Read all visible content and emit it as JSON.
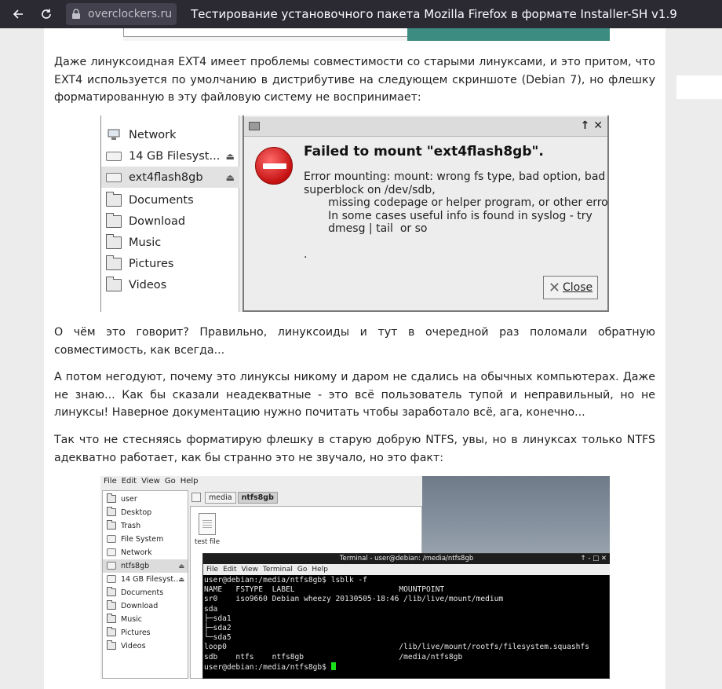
{
  "browser": {
    "domain": "overclockers.ru",
    "title": "Тестирование установочного пакета Mozilla Firefox в формате Installer-SH v1.9:..."
  },
  "article": {
    "p1": "Даже линуксоидная EXT4 имеет проблемы совместимости со старыми линуксами, и это притом, что EXT4 используется по умолчанию в дистрибутиве на следующем скриншоте (Debian 7), но флешку форматированную в эту файловую систему не воспринимает:",
    "p2": "О чём это говорит? Правильно, линуксоиды и тут в очередной раз поломали обратную совместимость, как всегда...",
    "p3": "А потом негодуют, почему это линуксы никому и даром не сдались на обычных компьютерах. Даже не знаю... Как бы сказали неадекватные - это всё пользователь тупой и неправильный, но не линуксы! Наверное документацию нужно почитать чтобы заработало всё, ага, конечно...",
    "p4": "Так что не стесняясь форматирую флешку в старую добрую NTFS, увы, но в линуксах только NTFS адекватно работает, как бы странно это не звучало, но это факт:"
  },
  "shot1": {
    "sidebar": [
      {
        "label": "Network",
        "icon": "network-icon"
      },
      {
        "label": "14 GB Filesyst...",
        "icon": "drive-icon"
      },
      {
        "label": "ext4flash8gb",
        "icon": "drive-icon"
      },
      {
        "label": "Documents",
        "icon": "folder-icon"
      },
      {
        "label": "Download",
        "icon": "folder-icon"
      },
      {
        "label": "Music",
        "icon": "folder-icon"
      },
      {
        "label": "Pictures",
        "icon": "folder-icon"
      },
      {
        "label": "Videos",
        "icon": "folder-icon"
      }
    ],
    "dialog": {
      "title_buttons": "↑ ✕",
      "heading": "Failed to mount \"ext4flash8gb\".",
      "message": "Error mounting: mount: wrong fs type, bad option, bad\nsuperblock on /dev/sdb,\n       missing codepage or helper program, or other error\n       In some cases useful info is found in syslog - try\n       dmesg | tail  or so\n\n.",
      "close_label": "Close"
    }
  },
  "shot2": {
    "menu": [
      "File",
      "Edit",
      "View",
      "Go",
      "Help"
    ],
    "sidebar": [
      "user",
      "Desktop",
      "Trash",
      "File System",
      "Network",
      "ntfs8gb",
      "14 GB Filesyst...",
      "Documents",
      "Download",
      "Music",
      "Pictures",
      "Videos"
    ],
    "crumbs": [
      "media",
      "ntfs8gb"
    ],
    "file": "test file",
    "terminal": {
      "title": "Terminal - user@debian: /media/ntfs8gb",
      "title_buttons": "↑ - □ ✕",
      "menu": [
        "File",
        "Edit",
        "View",
        "Terminal",
        "Go",
        "Help"
      ],
      "lines": "user@debian:/media/ntfs8gb$ lsblk -f\nNAME   FSTYPE  LABEL                       MOUNTPOINT\nsr0    iso9660 Debian wheezy 20130505-18:46 /lib/live/mount/medium\nsda\n├─sda1\n├─sda2\n└─sda5\nloop0                                      /lib/live/mount/rootfs/filesystem.squashfs\nsdb    ntfs    ntfs8gb                     /media/ntfs8gb\nuser@debian:/media/ntfs8gb$ "
    }
  }
}
